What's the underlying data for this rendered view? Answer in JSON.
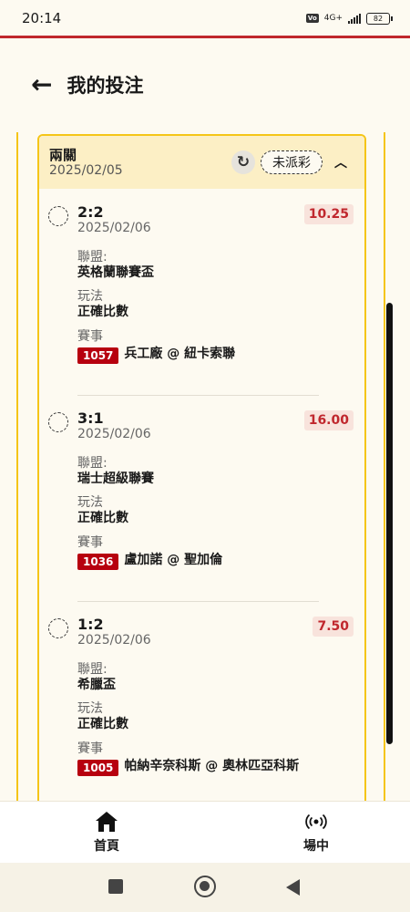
{
  "status_bar": {
    "time": "20:14",
    "network": "4G+",
    "battery": "82"
  },
  "header": {
    "title": "我的投注"
  },
  "bet": {
    "type": "兩關",
    "date": "2025/02/05",
    "status": "未派彩",
    "labels": {
      "league": "聯盟:",
      "play": "玩法",
      "match": "賽事"
    },
    "legs": [
      {
        "score": "2:2",
        "date": "2025/02/06",
        "odds": "10.25",
        "league": "英格蘭聯賽盃",
        "play": "正確比數",
        "match_no": "1057",
        "match": "兵工廠 @ 紐卡索聯"
      },
      {
        "score": "3:1",
        "date": "2025/02/06",
        "odds": "16.00",
        "league": "瑞士超級聯賽",
        "play": "正確比數",
        "match_no": "1036",
        "match": "盧加諾 @ 聖加倫"
      },
      {
        "score": "1:2",
        "date": "2025/02/06",
        "odds": "7.50",
        "league": "希臘盃",
        "play": "正確比數",
        "match_no": "1005",
        "match": "帕納辛奈科斯 @ 奧林匹亞科斯"
      }
    ]
  },
  "bottom_nav": {
    "home": "首頁",
    "live": "場中"
  },
  "icons": {
    "back": "arrow-left-icon",
    "refresh": "refresh-icon",
    "collapse": "chevron-up-icon",
    "home": "house-icon",
    "live": "broadcast-icon"
  },
  "colors": {
    "accent_red": "#c0272d",
    "card_border": "#f5c518",
    "card_header": "#fcefc5",
    "match_badge": "#b7000f"
  }
}
